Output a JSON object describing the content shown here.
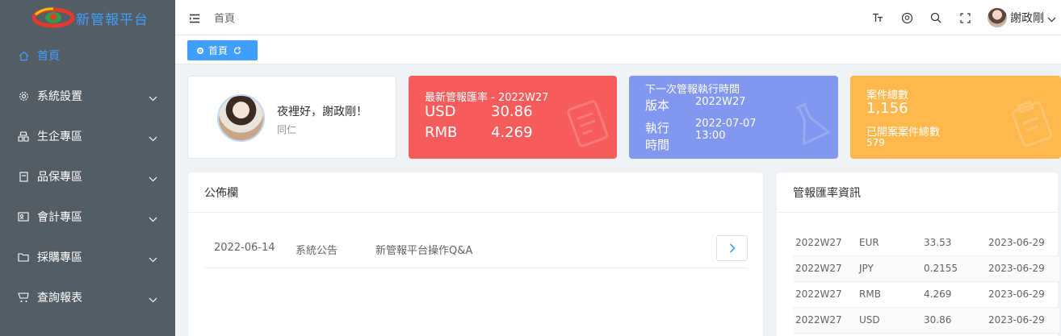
{
  "app": {
    "title": "新管報平台"
  },
  "sidebar": {
    "items": [
      {
        "label": "首頁",
        "icon": "home-icon",
        "active": true
      },
      {
        "label": "系統設置",
        "icon": "gear-icon"
      },
      {
        "label": "生企專區",
        "icon": "cubes-icon"
      },
      {
        "label": "品保專區",
        "icon": "document-icon"
      },
      {
        "label": "會計專區",
        "icon": "card-icon"
      },
      {
        "label": "採購專區",
        "icon": "folder-icon"
      },
      {
        "label": "查詢報表",
        "icon": "cart-icon"
      }
    ]
  },
  "header": {
    "breadcrumb": "首頁",
    "user_name": "謝政剛"
  },
  "tags": {
    "active_tag": "首頁"
  },
  "welcome": {
    "greeting": "夜裡好，謝政剛！",
    "role": "同仁"
  },
  "rate_card": {
    "title": "最新管報匯率 - 2022W27",
    "rows": [
      {
        "currency": "USD",
        "value": "30.86"
      },
      {
        "currency": "RMB",
        "value": "4.269"
      }
    ]
  },
  "exec_card": {
    "title": "下一次管報執行時間",
    "version_label": "版本",
    "version_value": "2022W27",
    "time_label_1": "執行",
    "time_label_2": "時間",
    "time_date": "2022-07-07",
    "time_clock": "13:00"
  },
  "case_card": {
    "title": "案件總數",
    "total": "1,156",
    "closed_label": "已開案案件總數",
    "closed_value": "579"
  },
  "notice": {
    "title": "公佈欄",
    "items": [
      {
        "date": "2022-06-14",
        "category": "系統公告",
        "subject": "新管報平台操作Q&A"
      }
    ]
  },
  "rates": {
    "title": "管報匯率資訊",
    "rows": [
      {
        "week": "2022W27",
        "currency": "EUR",
        "rate": "33.53",
        "date": "2023-06-29"
      },
      {
        "week": "2022W27",
        "currency": "JPY",
        "rate": "0.2155",
        "date": "2023-06-29"
      },
      {
        "week": "2022W27",
        "currency": "RMB",
        "rate": "4.269",
        "date": "2023-06-29"
      },
      {
        "week": "2022W27",
        "currency": "USD",
        "rate": "30.86",
        "date": "2023-06-29"
      }
    ]
  },
  "colors": {
    "sidebar_bg": "#545c64",
    "accent": "#409eff",
    "rate_card": "#f75c5c",
    "exec_card": "#8297f0",
    "case_card": "#ffb84d"
  }
}
